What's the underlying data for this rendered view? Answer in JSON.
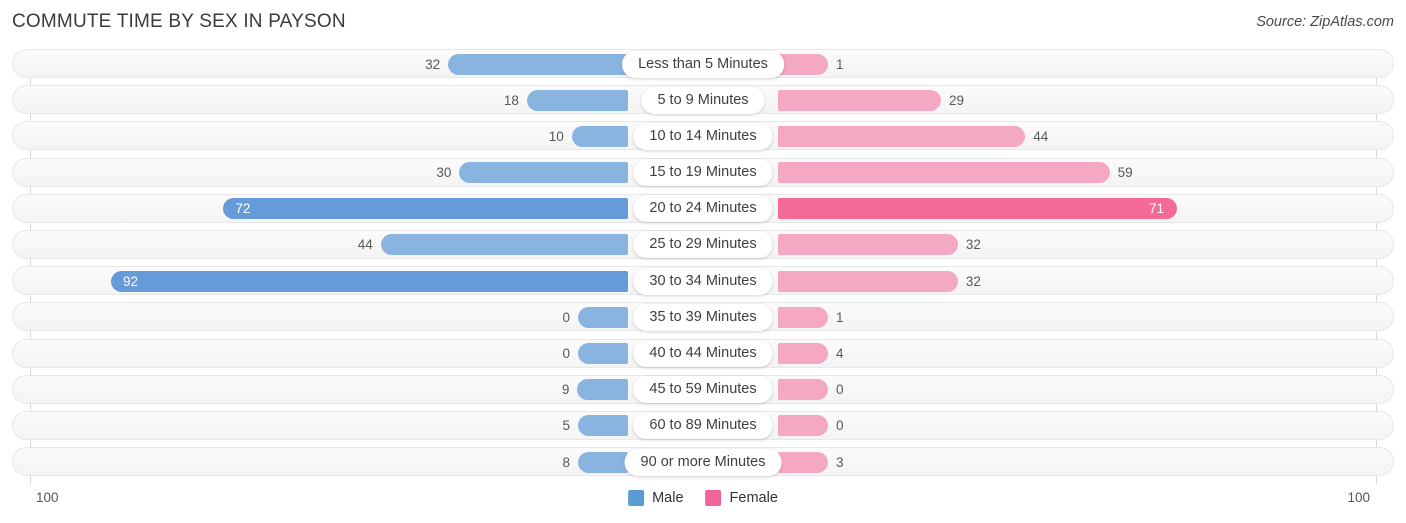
{
  "header": {
    "title": "COMMUTE TIME BY SEX IN PAYSON",
    "source": "Source: ZipAtlas.com"
  },
  "axis": {
    "left_tick": "100",
    "right_tick": "100",
    "max": 100
  },
  "legend": {
    "items": [
      {
        "label": "Male",
        "color": "#5b9bd5"
      },
      {
        "label": "Female",
        "color": "#f2659a"
      }
    ]
  },
  "colors": {
    "male_light": "#8ab4e0",
    "male_dark": "#659bd8",
    "female_light": "#f5a8c4",
    "female_dark": "#f26a95",
    "track_bg": "#f7f7f7",
    "track_border": "#e8e8e8"
  },
  "chart_data": {
    "type": "bar",
    "title": "COMMUTE TIME BY SEX IN PAYSON",
    "subtitle": "Source: ZipAtlas.com",
    "orientation": "horizontal-diverging",
    "xlabel": "",
    "ylabel": "",
    "xlim": [
      0,
      100
    ],
    "grid": false,
    "legend_position": "bottom-center",
    "categories": [
      "Less than 5 Minutes",
      "5 to 9 Minutes",
      "10 to 14 Minutes",
      "15 to 19 Minutes",
      "20 to 24 Minutes",
      "25 to 29 Minutes",
      "30 to 34 Minutes",
      "35 to 39 Minutes",
      "40 to 44 Minutes",
      "45 to 59 Minutes",
      "60 to 89 Minutes",
      "90 or more Minutes"
    ],
    "series": [
      {
        "name": "Male",
        "values": [
          32,
          18,
          10,
          30,
          72,
          44,
          92,
          0,
          0,
          9,
          5,
          8
        ]
      },
      {
        "name": "Female",
        "values": [
          1,
          29,
          44,
          59,
          71,
          32,
          32,
          1,
          4,
          0,
          0,
          3
        ]
      }
    ]
  },
  "rows": [
    {
      "category": "Less than 5 Minutes",
      "male": "32",
      "female": "1",
      "male_inside": false,
      "female_inside": false
    },
    {
      "category": "5 to 9 Minutes",
      "male": "18",
      "female": "29",
      "male_inside": false,
      "female_inside": false
    },
    {
      "category": "10 to 14 Minutes",
      "male": "10",
      "female": "44",
      "male_inside": false,
      "female_inside": false
    },
    {
      "category": "15 to 19 Minutes",
      "male": "30",
      "female": "59",
      "male_inside": false,
      "female_inside": false
    },
    {
      "category": "20 to 24 Minutes",
      "male": "72",
      "female": "71",
      "male_inside": true,
      "female_inside": true
    },
    {
      "category": "25 to 29 Minutes",
      "male": "44",
      "female": "32",
      "male_inside": false,
      "female_inside": false
    },
    {
      "category": "30 to 34 Minutes",
      "male": "92",
      "female": "32",
      "male_inside": true,
      "female_inside": false
    },
    {
      "category": "35 to 39 Minutes",
      "male": "0",
      "female": "1",
      "male_inside": false,
      "female_inside": false
    },
    {
      "category": "40 to 44 Minutes",
      "male": "0",
      "female": "4",
      "male_inside": false,
      "female_inside": false
    },
    {
      "category": "45 to 59 Minutes",
      "male": "9",
      "female": "0",
      "male_inside": false,
      "female_inside": false
    },
    {
      "category": "60 to 89 Minutes",
      "male": "5",
      "female": "0",
      "male_inside": false,
      "female_inside": false
    },
    {
      "category": "90 or more Minutes",
      "male": "8",
      "female": "3",
      "male_inside": false,
      "female_inside": false
    }
  ]
}
